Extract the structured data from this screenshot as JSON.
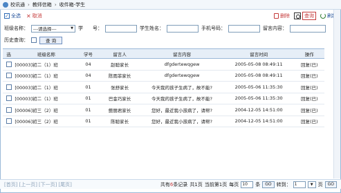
{
  "breadcrumb": {
    "items": [
      "校讯通",
      "教师信箱",
      "收件箱-学生"
    ]
  },
  "toolbar": {
    "select_all": "全选",
    "cancel": "取消",
    "delete": "删除",
    "query": "查询",
    "refresh": "刷新"
  },
  "search": {
    "class_label": "班级名称：",
    "class_select": "---请选择---",
    "student_no_label": "学　　号：",
    "student_name_label": "学生姓名：",
    "phone_label": "手机号码：",
    "message_label": "留言内容：",
    "history_label": "历史查询：",
    "query_button": "查 询"
  },
  "table": {
    "headers": [
      "选",
      "班级名称",
      "学号",
      "留言人",
      "留言内容",
      "留言时间",
      "操作"
    ],
    "rows": [
      {
        "class": "[00003]初二（1）班",
        "no": "04",
        "sender": "赵聪家长",
        "content": "dfgdertewqgew",
        "time": "2005-05-08 08:49:11",
        "action": "回复(已)"
      },
      {
        "class": "[00003]初二（1）班",
        "no": "04",
        "sender": "陈雨菲家长",
        "content": "dfgdertewqgew",
        "time": "2005-05-08 08:49:11",
        "action": "回复(已)"
      },
      {
        "class": "[00003]初二（1）班",
        "no": "01",
        "sender": "张舒家长",
        "content": "今天我的孩子生病了，故不能?",
        "time": "2005-05-06 11:35:30",
        "action": "回复(已)"
      },
      {
        "class": "[00003]初二（1）班",
        "no": "01",
        "sender": "巴金巧家长",
        "content": "今天我的孩子生病了，故不能?",
        "time": "2005-05-06 11:35:30",
        "action": "回复(已)"
      },
      {
        "class": "[00006]初三（2）班",
        "no": "01",
        "sender": "鲍丽君家长",
        "content": "您好，最近我小孩病了，请帮?",
        "time": "2004-12-05 14:51:00",
        "action": "回复(已)"
      },
      {
        "class": "[00006]初三（2）班",
        "no": "01",
        "sender": "陈聪家长",
        "content": "您好，最近我小孩病了，请帮?",
        "time": "2004-12-05 14:51:00",
        "action": "回复(已)"
      }
    ]
  },
  "pager": {
    "first": "[首页]",
    "prev": "[上一页]",
    "next": "[下一页]",
    "last": "[尾页]",
    "total_prefix": "共有",
    "total_count": "6",
    "total_suffix": "条记录",
    "pages_text": "共1页",
    "current_prefix": "当前第",
    "current_page": "1",
    "current_suffix": "页",
    "per_page_label": "每页",
    "per_page_value": "10",
    "per_page_unit": "条",
    "go1": "GO",
    "jump_label": "转到：",
    "jump_value": "1",
    "jump_unit": "页",
    "go2": "GO"
  }
}
